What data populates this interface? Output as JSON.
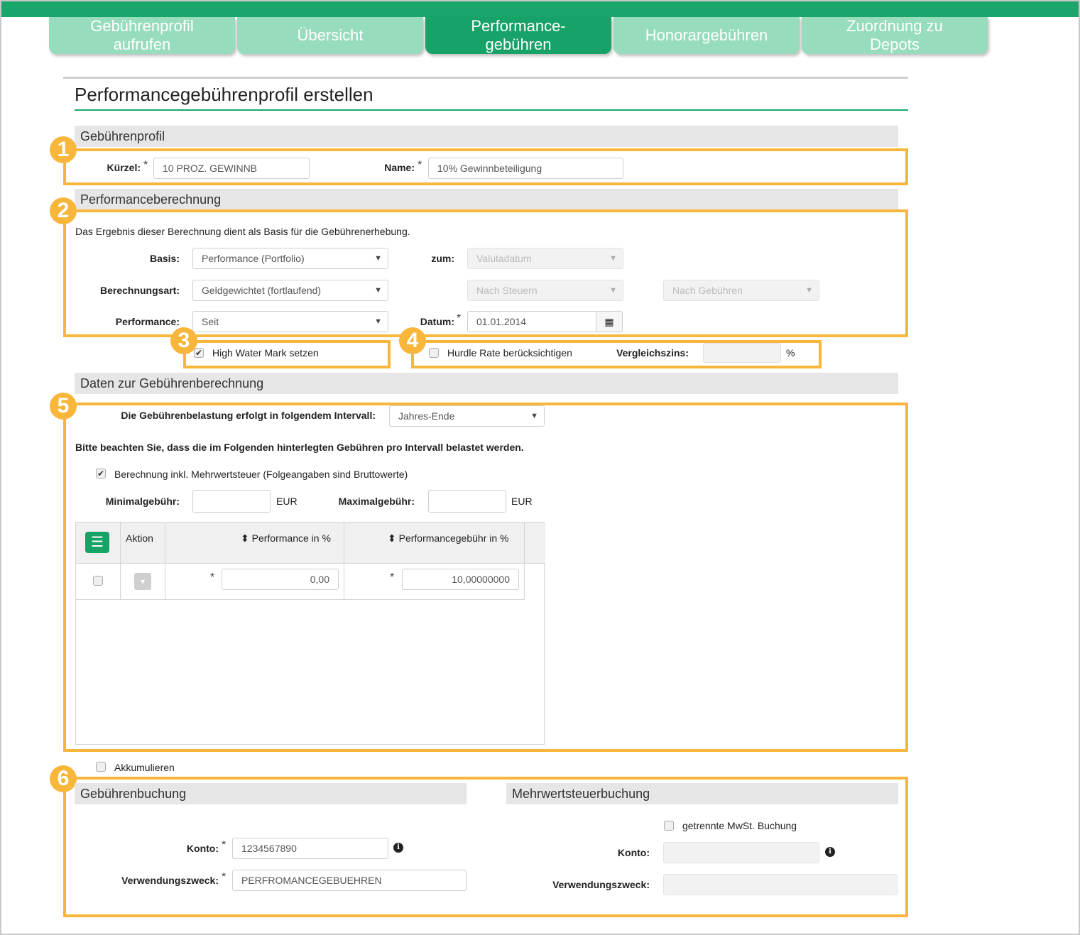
{
  "tabs": [
    {
      "line1": "Gebührenprofil",
      "line2": "aufrufen"
    },
    {
      "line1": "Übersicht",
      "line2": ""
    },
    {
      "line1": "Performance-",
      "line2": "gebühren"
    },
    {
      "line1": "Honorargebühren",
      "line2": ""
    },
    {
      "line1": "Zuordnung zu",
      "line2": "Depots"
    }
  ],
  "page_title": "Performancegebührenprofil erstellen",
  "badges": [
    "1",
    "2",
    "3",
    "4",
    "5",
    "6"
  ],
  "profile": {
    "section_title": "Gebührenprofil",
    "kuerzel_label": "Kürzel:",
    "kuerzel_value": "10 PROZ. GEWINNB",
    "name_label": "Name:",
    "name_value": "10% Gewinnbeteiligung",
    "required_mark": "*"
  },
  "calc": {
    "section_title": "Performanceberechnung",
    "description": "Das Ergebnis dieser Berechnung dient als Basis für die Gebührenerhebung.",
    "basis_label": "Basis:",
    "basis_value": "Performance (Portfolio)",
    "zum_label": "zum:",
    "zum_value": "Valutadatum",
    "berechnungsart_label": "Berechnungsart:",
    "berechnungsart_value": "Geldgewichtet (fortlaufend)",
    "steuern_value": "Nach Steuern",
    "gebuehren_value": "Nach Gebühren",
    "performance_label": "Performance:",
    "performance_value": "Seit",
    "datum_label": "Datum:",
    "datum_value": "01.01.2014",
    "calendar_icon": "calendar-icon"
  },
  "hwm": {
    "label": "High Water Mark setzen",
    "checked": true
  },
  "hurdle": {
    "label": "Hurdle Rate berücksichtigen",
    "checked": false,
    "vergleich_label": "Vergleichszins:",
    "vergleich_value": "",
    "unit": "%"
  },
  "fee_data": {
    "section_title": "Daten zur Gebührenberechnung",
    "interval_label": "Die Gebührenbelastung erfolgt in folgendem Intervall:",
    "interval_value": "Jahres-Ende",
    "note": "Bitte beachten Sie, dass die im Folgenden hinterlegten Gebühren pro Intervall belastet werden.",
    "mwst_label": "Berechnung inkl. Mehrwertsteuer (Folgeangaben sind Bruttowerte)",
    "mwst_checked": true,
    "min_label": "Minimalgebühr:",
    "min_value": "",
    "max_label": "Maximalgebühr:",
    "max_value": "",
    "currency": "EUR",
    "table": {
      "col_action": "Aktion",
      "col_perf": "Performance in %",
      "col_fee": "Performancegebühr in %",
      "sort_icon": "⬍",
      "rows": [
        {
          "performance": "0,00",
          "fee": "10,00000000"
        }
      ]
    }
  },
  "akkumulieren": {
    "label": "Akkumulieren",
    "checked": false
  },
  "booking": {
    "section_title": "Gebührenbuchung",
    "konto_label": "Konto:",
    "konto_value": "1234567890",
    "zweck_label": "Verwendungszweck:",
    "zweck_value": "PERFROMANCEGEBUEHREN"
  },
  "vat_booking": {
    "section_title": "Mehrwertsteuerbuchung",
    "separate_label": "getrennte MwSt. Buchung",
    "separate_checked": false,
    "konto_label": "Konto:",
    "konto_value": "",
    "zweck_label": "Verwendungszweck:",
    "zweck_value": ""
  },
  "colors": {
    "brand_green": "#1aa66a",
    "tab_light": "#97dcbc",
    "highlight": "#f8b63a"
  }
}
